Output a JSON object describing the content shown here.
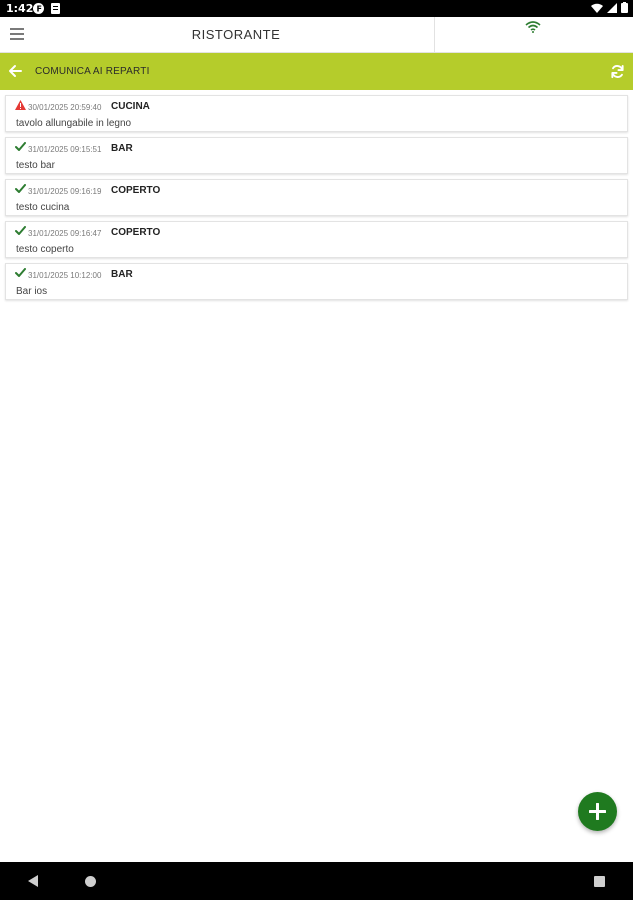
{
  "status_bar": {
    "time": "1:42",
    "icons": [
      "app-f-icon",
      "app-notes-icon",
      "wifi-icon",
      "signal-icon",
      "battery-icon"
    ]
  },
  "header": {
    "title": "RISTORANTE",
    "menu_icon": "menu-icon",
    "connection_icon": "wifi-icon",
    "connection_color": "#2e7d32"
  },
  "section": {
    "title": "COMUNICA AI REPARTI",
    "back_icon": "arrow-left-icon",
    "refresh_icon": "refresh-icon",
    "background": "#b5cc2b"
  },
  "messages": [
    {
      "status": "error",
      "status_icon": "warning-icon",
      "timestamp": "30/01/2025 20:59:40",
      "department": "CUCINA",
      "text": "tavolo allungabile in legno"
    },
    {
      "status": "sent",
      "status_icon": "check-icon",
      "timestamp": "31/01/2025 09:15:51",
      "department": "BAR",
      "text": "testo bar"
    },
    {
      "status": "sent",
      "status_icon": "check-icon",
      "timestamp": "31/01/2025 09:16:19",
      "department": "COPERTO",
      "text": "testo cucina"
    },
    {
      "status": "sent",
      "status_icon": "check-icon",
      "timestamp": "31/01/2025 09:16:47",
      "department": "COPERTO",
      "text": "testo coperto"
    },
    {
      "status": "sent",
      "status_icon": "check-icon",
      "timestamp": "31/01/2025 10:12:00",
      "department": "BAR",
      "text": "Bar ios"
    }
  ],
  "fab": {
    "icon": "plus-icon",
    "color": "#1f7a1f"
  },
  "nav_bar": {
    "icons": [
      "nav-back-icon",
      "nav-home-icon",
      "nav-recents-icon"
    ]
  },
  "colors": {
    "error": "#e53935",
    "success": "#2e7d32"
  }
}
